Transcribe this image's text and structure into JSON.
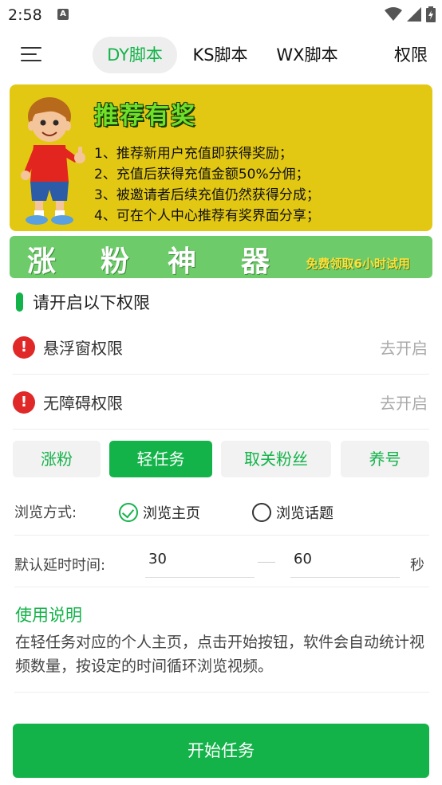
{
  "status_bar": {
    "time": "2:58",
    "notification_icon": "a-letter-icon",
    "icons": [
      "wifi-icon",
      "signal-icon",
      "battery-icon"
    ]
  },
  "top_nav": {
    "menu_icon": "menu-icon",
    "tabs": [
      {
        "label": "DY脚本",
        "active": true
      },
      {
        "label": "KS脚本",
        "active": false
      },
      {
        "label": "WX脚本",
        "active": false
      },
      {
        "label": "权限",
        "active": false
      }
    ]
  },
  "promo_banner": {
    "title": "推荐有奖",
    "lines": [
      "1、推荐新用户充值即获得奖励；",
      "2、充值后获得充值金额50%分佣；",
      "3、被邀请者后续充值仍然获得分成；",
      "4、可在个人中心推荐有奖界面分享；"
    ]
  },
  "growth_banner": {
    "chars": [
      "涨",
      "粉",
      "神",
      "器"
    ],
    "subtitle": "免费领取6小时试用"
  },
  "permissions": {
    "title": "请开启以下权限",
    "items": [
      {
        "label": "悬浮窗权限",
        "action": "去开启"
      },
      {
        "label": "无障碍权限",
        "action": "去开启"
      }
    ]
  },
  "modes": {
    "items": [
      {
        "label": "涨粉",
        "active": false
      },
      {
        "label": "轻任务",
        "active": true
      },
      {
        "label": "取关粉丝",
        "active": false
      },
      {
        "label": "养号",
        "active": false
      }
    ]
  },
  "browse": {
    "label": "浏览方式:",
    "options": [
      {
        "label": "浏览主页",
        "checked": true
      },
      {
        "label": "浏览话题",
        "checked": false
      }
    ]
  },
  "delay": {
    "label": "默认延时时间:",
    "min_value": "30",
    "max_value": "60",
    "unit": "秒"
  },
  "instructions": {
    "title": "使用说明",
    "body": "在轻任务对应的个人主页，点击开始按钮，软件会自动统计视频数量，按设定的时间循环浏览视频。"
  },
  "start_button": {
    "label": "开始任务"
  },
  "colors": {
    "accent": "#14b34a",
    "banner_yellow": "#e3c813",
    "growth_green": "#6dcb6a",
    "warning_red": "#e12828"
  }
}
